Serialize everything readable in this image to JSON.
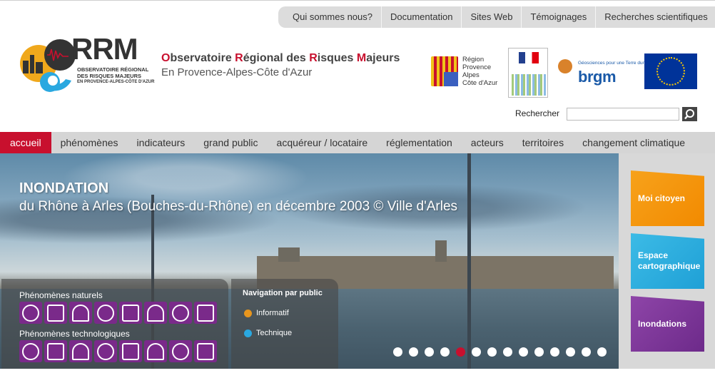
{
  "topnav": [
    "Qui sommes nous?",
    "Documentation",
    "Sites Web",
    "Témoignages",
    "Recherches scientifiques"
  ],
  "logo": {
    "title_parts": [
      {
        "t": "O",
        "r": true
      },
      {
        "t": "bservatoire ",
        "r": false
      },
      {
        "t": "R",
        "r": true
      },
      {
        "t": "égional des ",
        "r": false
      },
      {
        "t": "R",
        "r": true
      },
      {
        "t": "isques ",
        "r": false
      },
      {
        "t": "M",
        "r": true
      },
      {
        "t": "ajeurs",
        "r": false
      }
    ],
    "subtitle": "En Provence-Alpes-Côte d'Azur",
    "mark": "RRM",
    "mark_lines": [
      "OBSERVATOIRE RÉGIONAL",
      "DES RISQUES MAJEURS",
      "EN PROVENCE-ALPES-CÔTE D'AZUR"
    ]
  },
  "partners": {
    "region_lines": [
      "Région",
      "Provence",
      "Alpes",
      "Côte d'Azur"
    ],
    "brgm_tag": "Géosciences pour une Terre durable",
    "brgm_name": "brgm"
  },
  "search": {
    "label": "Rechercher",
    "value": ""
  },
  "mainnav": [
    {
      "label": "accueil",
      "active": true
    },
    {
      "label": "phénomènes",
      "active": false
    },
    {
      "label": "indicateurs",
      "active": false
    },
    {
      "label": "grand public",
      "active": false
    },
    {
      "label": "acquéreur / locataire",
      "active": false
    },
    {
      "label": "réglementation",
      "active": false
    },
    {
      "label": "acteurs",
      "active": false
    },
    {
      "label": "territoires",
      "active": false
    },
    {
      "label": "changement climatique",
      "active": false
    }
  ],
  "hero": {
    "title": "INONDATION",
    "caption": "du Rhône à Arles (Bouches-du-Rhône) en décembre 2003 © Ville d'Arles"
  },
  "phenomenes": {
    "natural_heading": "Phénomènes naturels",
    "tech_heading": "Phénomènes technologiques",
    "natural_icons": [
      "avalanche-icon",
      "mouvement-terrain-icon",
      "feu-foret-icon",
      "seisme-icon",
      "inondation-icon",
      "submersion-icon",
      "tempete-icon",
      "retrait-gonflement-icon"
    ],
    "tech_icons": [
      "industriel-icon",
      "nucleaire-icon",
      "transport-matieres-icon",
      "barrage-icon",
      "tunnel-icon",
      "rupture-digue-icon",
      "mine-icon",
      "gaz-icon"
    ]
  },
  "public_nav": {
    "heading": "Navigation par public",
    "items": [
      {
        "label": "Informatif",
        "color": "#e8961e"
      },
      {
        "label": "Technique",
        "color": "#2aa8e0"
      }
    ]
  },
  "carousel": {
    "count": 14,
    "active_index": 4
  },
  "right_buttons": [
    {
      "label": "Moi citoyen"
    },
    {
      "label": "Espace cartographique"
    },
    {
      "label": "Inondations"
    }
  ],
  "colors": {
    "brand_red": "#c8102e",
    "purple": "#7a2a8a",
    "orange": "#f28a00",
    "blue": "#1fa0d6"
  }
}
